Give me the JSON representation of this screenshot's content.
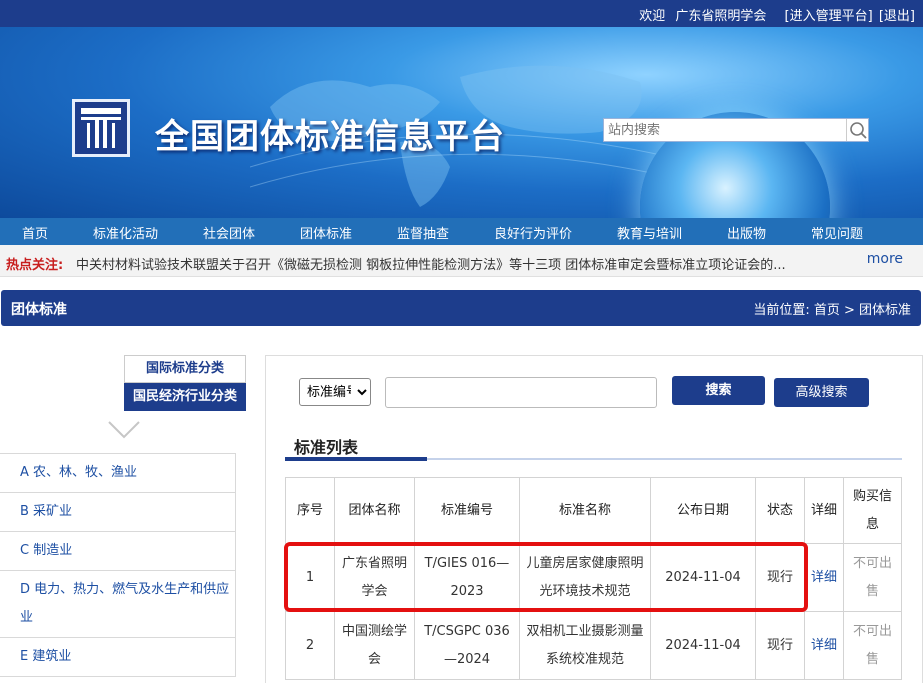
{
  "topbar": {
    "welcome": "欢迎",
    "user": "广东省照明学会",
    "enter_admin": "[进入管理平台]",
    "logout": "[退出]"
  },
  "banner": {
    "site_title": "全国团体标准信息平台",
    "search_placeholder": "站内搜索"
  },
  "nav": {
    "items": [
      "首页",
      "标准化活动",
      "社会团体",
      "团体标准",
      "监督抽查",
      "良好行为评价",
      "教育与培训",
      "出版物",
      "常见问题"
    ]
  },
  "hot": {
    "label": "热点关注:",
    "text": "中关村材料试验技术联盟关于召开《微磁无损检测 钢板拉伸性能检测方法》等十三项 团体标准审定会暨标准立项论证会的...",
    "more": "more"
  },
  "section": {
    "title": "团体标准",
    "breadcrumb": "当前位置: 首页 > 团体标准"
  },
  "sidebar": {
    "tab_intl": "国际标准分类",
    "tab_national": "国民经济行业分类",
    "categories": [
      "A 农、林、牧、渔业",
      "B 采矿业",
      "C 制造业",
      "D 电力、热力、燃气及水生产和供应业",
      "E 建筑业"
    ]
  },
  "search_form": {
    "field_select": "标准编号",
    "keyword_value": "",
    "search_btn": "搜索",
    "advanced_btn": "高级搜索"
  },
  "list": {
    "title": "标准列表",
    "headers": [
      "序号",
      "团体名称",
      "标准编号",
      "标准名称",
      "公布日期",
      "状态",
      "详细",
      "购买信息"
    ],
    "rows": [
      {
        "no": "1",
        "org": "广东省照明学会",
        "code": "T/GIES 016—2023",
        "name": "儿童房居家健康照明光环境技术规范",
        "date": "2024-11-04",
        "status": "现行",
        "detail": "详细",
        "buy": "不可出售"
      },
      {
        "no": "2",
        "org": "中国测绘学会",
        "code": "T/CSGPC 036—2024",
        "name": "双相机工业摄影测量系统校准规范",
        "date": "2024-11-04",
        "status": "现行",
        "detail": "详细",
        "buy": "不可出售"
      }
    ]
  },
  "colors": {
    "primary": "#1d3d8c",
    "nav": "#226fb8",
    "highlight": "#e41010",
    "hot_label": "#c81e1e"
  }
}
